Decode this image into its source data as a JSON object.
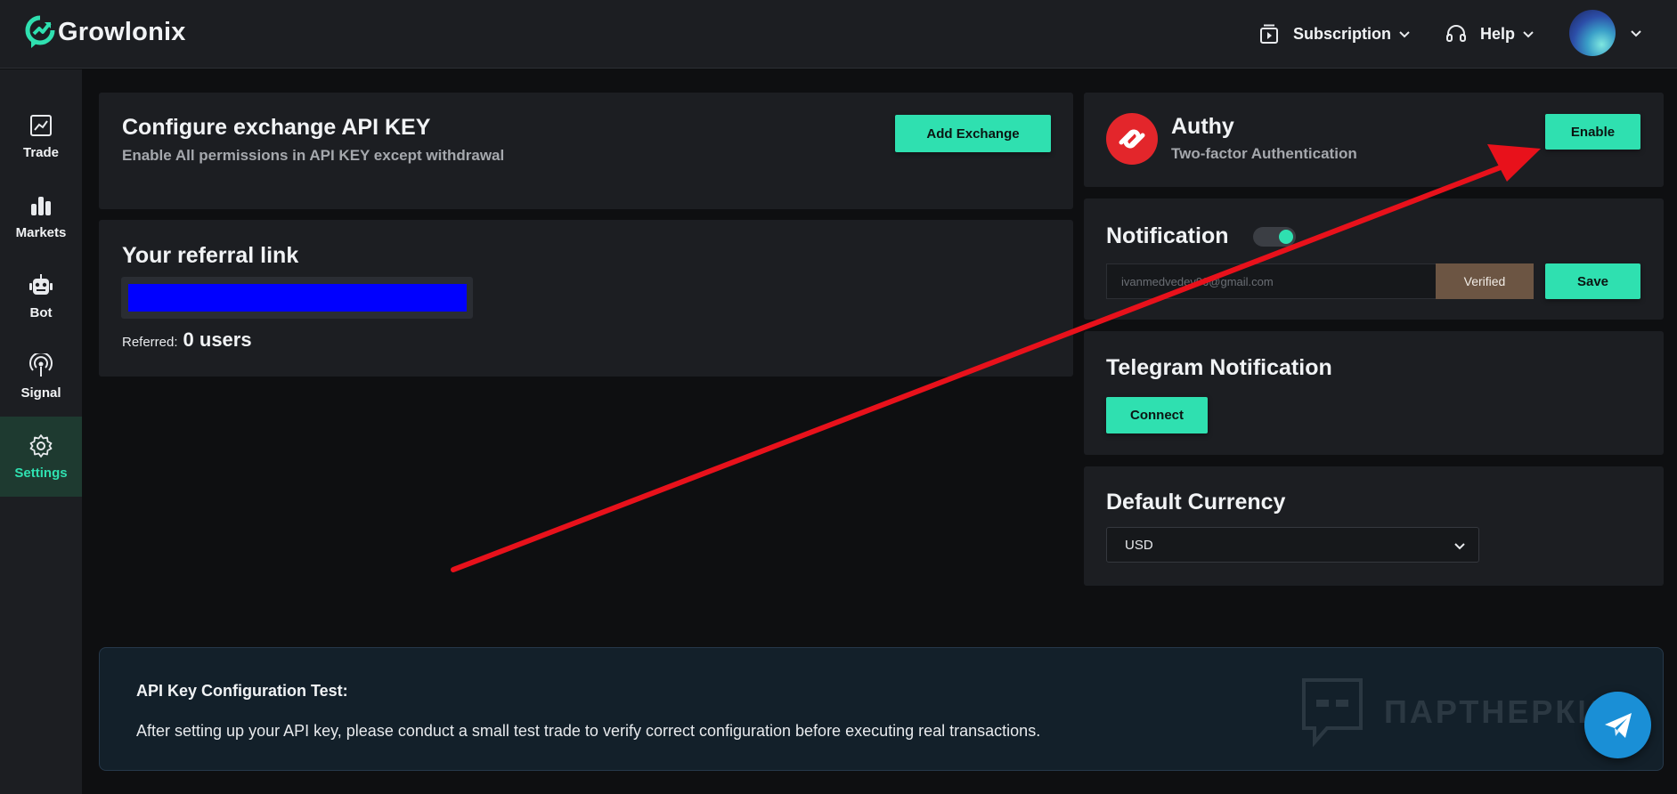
{
  "header": {
    "brand": "Growlonix",
    "subscription_label": "Subscription",
    "help_label": "Help"
  },
  "sidebar": {
    "items": [
      {
        "label": "Trade",
        "icon": "chart-line-icon"
      },
      {
        "label": "Markets",
        "icon": "bar-chart-icon"
      },
      {
        "label": "Bot",
        "icon": "robot-icon"
      },
      {
        "label": "Signal",
        "icon": "broadcast-icon"
      },
      {
        "label": "Settings",
        "icon": "gear-icon",
        "active": true
      }
    ]
  },
  "api_key": {
    "title": "Configure exchange API KEY",
    "subtitle": "Enable All permissions in API KEY except withdrawal",
    "button": "Add Exchange"
  },
  "referral": {
    "title": "Your referral link",
    "referred_label": "Referred:",
    "referred_count": "0 users"
  },
  "authy": {
    "title": "Authy",
    "subtitle": "Two-factor Authentication",
    "button": "Enable"
  },
  "notification": {
    "title": "Notification",
    "toggle_on": true,
    "email_value": "ivanmedvedev96@gmail.com",
    "verified_label": "Verified",
    "save_button": "Save"
  },
  "telegram": {
    "title": "Telegram Notification",
    "button": "Connect"
  },
  "currency": {
    "title": "Default Currency",
    "selected": "USD"
  },
  "notice": {
    "title": "API Key Configuration Test:",
    "text": "After setting up your API key, please conduct a small test trade to verify correct configuration before executing real transactions."
  },
  "watermark": {
    "text": "ПАРТНЕРКИН"
  },
  "colors": {
    "accent": "#2fe0b0",
    "background": "#0e0f11",
    "panel": "#1c1e22",
    "annotation_arrow": "#e8111b",
    "authy_red": "#e3262b",
    "fab_blue": "#1a8fd6"
  }
}
